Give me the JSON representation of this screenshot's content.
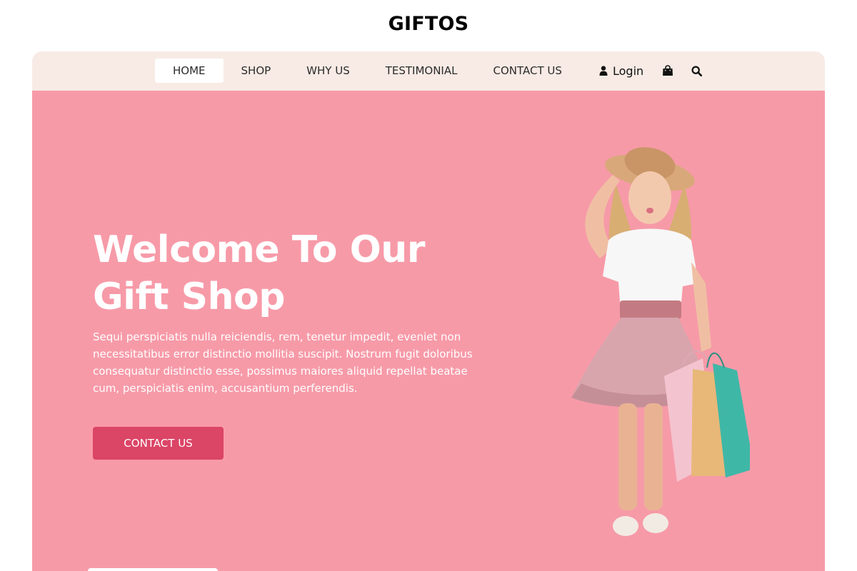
{
  "brand": {
    "name": "GIFTOS"
  },
  "nav": {
    "items": [
      {
        "label": "HOME",
        "active": true
      },
      {
        "label": "SHOP",
        "active": false
      },
      {
        "label": "WHY US",
        "active": false
      },
      {
        "label": "TESTIMONIAL",
        "active": false
      },
      {
        "label": "CONTACT US",
        "active": false
      }
    ],
    "login_label": "Login",
    "icons": [
      "user-icon",
      "shopping-bag-icon",
      "search-icon"
    ]
  },
  "hero": {
    "title_line1": "Welcome To Our",
    "title_line2": "Gift Shop",
    "text": "Sequi perspiciatis nulla reiciendis, rem, tenetur impedit, eveniet non necessitatibus error distinctio mollitia suscipit. Nostrum fugit doloribus consequatur distinctio esse, possimus maiores aliquid repellat beatae cum, perspiciatis enim, accusantium perferendis.",
    "button_label": "CONTACT US"
  },
  "colors": {
    "nav_bg": "#f8ebe5",
    "hero_bg": "#f79aa8",
    "button_bg": "#db4566",
    "text_on_hero": "#ffffff"
  }
}
